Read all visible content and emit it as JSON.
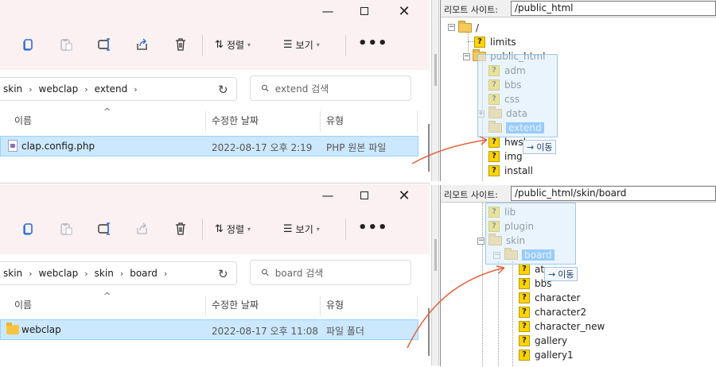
{
  "top_explorer": {
    "toolbar": {
      "sort_label": "정렬",
      "view_label": "보기",
      "more_label": "•••"
    },
    "breadcrumb": [
      "skin",
      "webclap",
      "extend"
    ],
    "search_placeholder": "extend 검색",
    "columns": {
      "name": "이름",
      "modified": "수정한 날짜",
      "type": "유형"
    },
    "file": {
      "name": "clap.config.php",
      "modified": "2022-08-17 오후 2:19",
      "type": "PHP 원본 파일",
      "icon": "php-file-icon"
    }
  },
  "bottom_explorer": {
    "toolbar": {
      "sort_label": "정렬",
      "view_label": "보기",
      "more_label": "•••"
    },
    "breadcrumb": [
      "skin",
      "webclap",
      "skin",
      "board"
    ],
    "search_placeholder": "board 검색",
    "columns": {
      "name": "이름",
      "modified": "수정한 날짜",
      "type": "유형"
    },
    "file": {
      "name": "webclap",
      "modified": "2022-08-17 오후 11:08",
      "type": "파일 폴더",
      "icon": "folder-icon"
    }
  },
  "top_remote": {
    "label": "리모트 사이트:",
    "path": "/public_html",
    "items": [
      {
        "name": "/",
        "kind": "folder"
      },
      {
        "name": "limits",
        "kind": "unknown"
      },
      {
        "name": "public_html",
        "kind": "folder"
      },
      {
        "name": "adm",
        "kind": "unknown"
      },
      {
        "name": "bbs",
        "kind": "unknown"
      },
      {
        "name": "css",
        "kind": "unknown"
      },
      {
        "name": "data",
        "kind": "folder"
      },
      {
        "name": "extend",
        "kind": "folder",
        "selected": true
      },
      {
        "name": "hwsl",
        "kind": "unknown"
      },
      {
        "name": "img",
        "kind": "unknown"
      },
      {
        "name": "install",
        "kind": "unknown"
      }
    ],
    "tooltip": "이동"
  },
  "bottom_remote": {
    "label": "리모트 사이트:",
    "path": "/public_html/skin/board",
    "items": [
      {
        "name": "lib",
        "kind": "unknown"
      },
      {
        "name": "plugin",
        "kind": "unknown"
      },
      {
        "name": "skin",
        "kind": "folder"
      },
      {
        "name": "board",
        "kind": "folder",
        "selected": true
      },
      {
        "name": "at",
        "kind": "unknown"
      },
      {
        "name": "bbs",
        "kind": "unknown"
      },
      {
        "name": "character",
        "kind": "unknown"
      },
      {
        "name": "character2",
        "kind": "unknown"
      },
      {
        "name": "character_new",
        "kind": "unknown"
      },
      {
        "name": "gallery",
        "kind": "unknown"
      },
      {
        "name": "gallery1",
        "kind": "unknown"
      }
    ],
    "tooltip": "이동"
  },
  "colors": {
    "selection": "#cce8ff",
    "tree_selection": "#3399ff",
    "arrow": "#e8603c",
    "titlebar": "#fbf0f2"
  }
}
